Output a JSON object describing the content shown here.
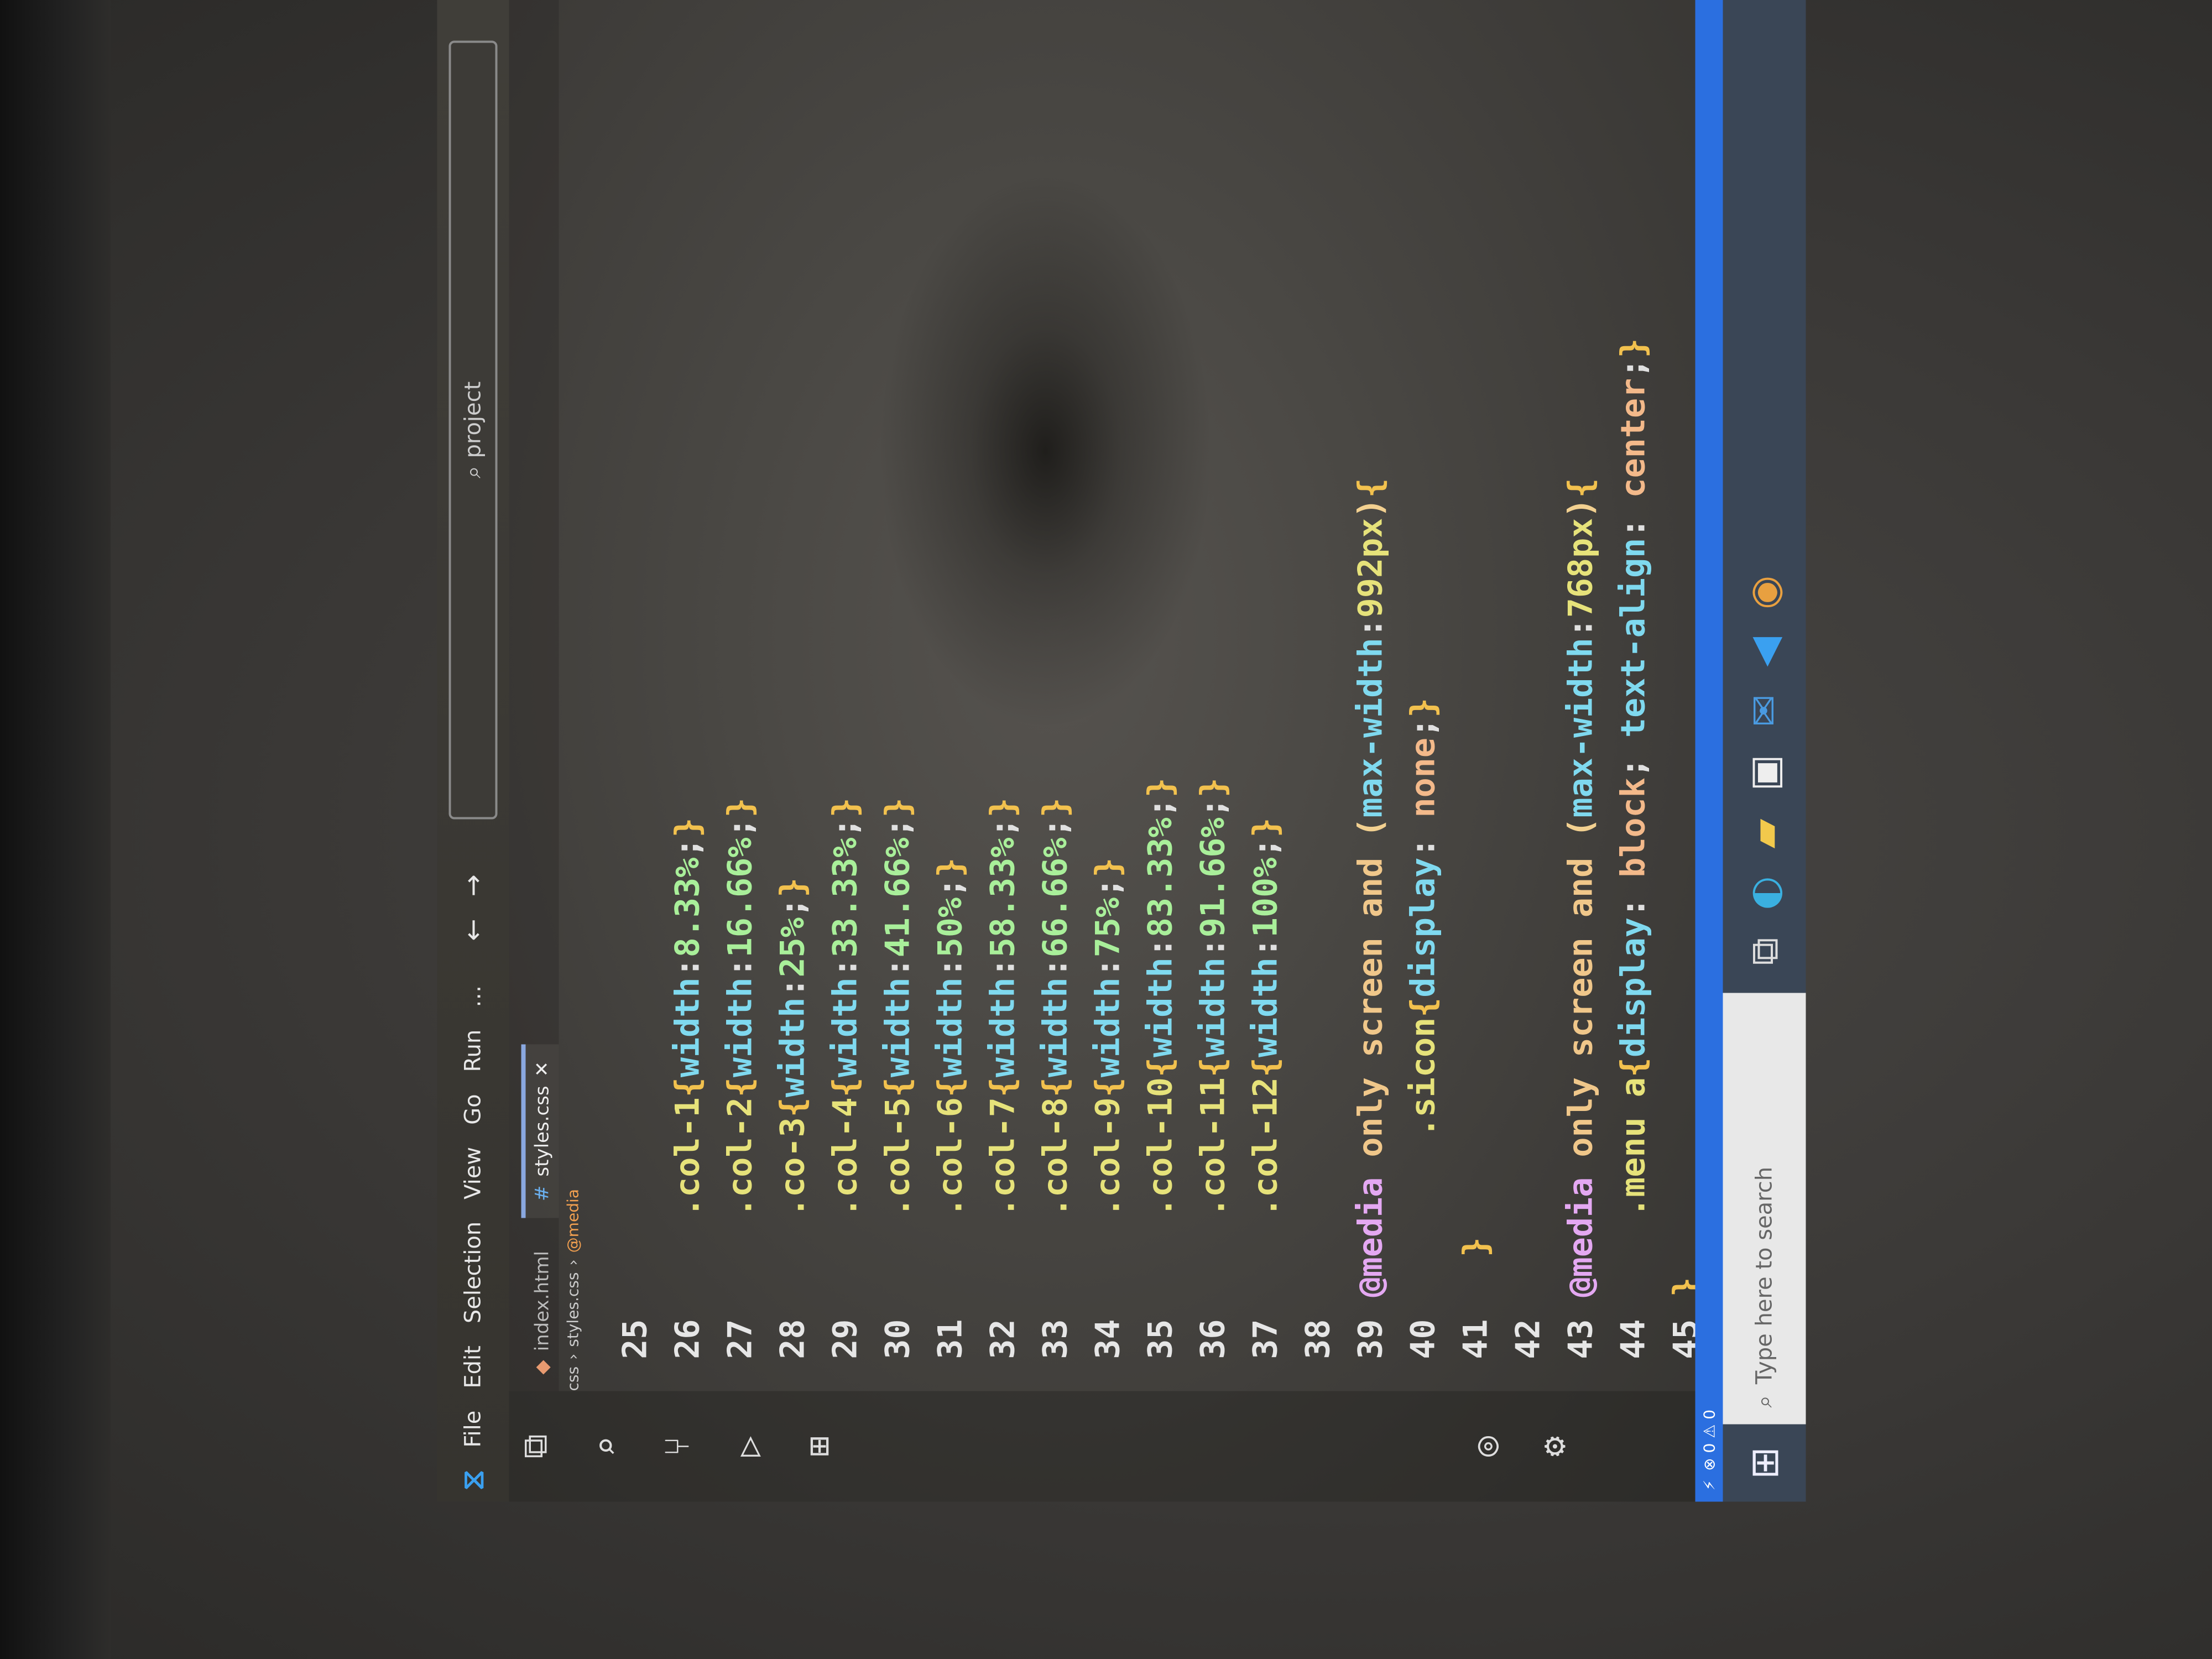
{
  "titlebar": {
    "menu": [
      "File",
      "Edit",
      "Selection",
      "View",
      "Go",
      "Run",
      "…"
    ],
    "search_placeholder": "project"
  },
  "tabs": [
    {
      "label": "index.html",
      "active": false
    },
    {
      "label": "styles.css",
      "active": true,
      "close": "✕"
    }
  ],
  "breadcrumb": [
    "css",
    "styles.css",
    "@media"
  ],
  "code": {
    "lines": [
      {
        "n": "25",
        "tokens": []
      },
      {
        "n": "26",
        "tokens": [
          [
            "    .col-1",
            "sel"
          ],
          [
            "{",
            "brace"
          ],
          [
            "width",
            "prop"
          ],
          [
            ":",
            "punc"
          ],
          [
            "8.33%",
            "val"
          ],
          [
            ";",
            "punc"
          ],
          [
            "}",
            "brace"
          ]
        ]
      },
      {
        "n": "27",
        "tokens": [
          [
            "    .col-2",
            "sel"
          ],
          [
            "{",
            "brace"
          ],
          [
            "width",
            "prop"
          ],
          [
            ":",
            "punc"
          ],
          [
            "16.66%",
            "val"
          ],
          [
            ";",
            "punc"
          ],
          [
            "}",
            "brace"
          ]
        ]
      },
      {
        "n": "28",
        "tokens": [
          [
            "    .co-3",
            "sel"
          ],
          [
            "{",
            "brace"
          ],
          [
            "width",
            "prop"
          ],
          [
            ":",
            "punc"
          ],
          [
            "25%",
            "val"
          ],
          [
            ";",
            "punc"
          ],
          [
            "}",
            "brace"
          ]
        ]
      },
      {
        "n": "29",
        "tokens": [
          [
            "    .col-4",
            "sel"
          ],
          [
            "{",
            "brace"
          ],
          [
            "width",
            "prop"
          ],
          [
            ":",
            "punc"
          ],
          [
            "33.33%",
            "val"
          ],
          [
            ";",
            "punc"
          ],
          [
            "}",
            "brace"
          ]
        ]
      },
      {
        "n": "30",
        "tokens": [
          [
            "    .col-5",
            "sel"
          ],
          [
            "{",
            "brace"
          ],
          [
            "width",
            "prop"
          ],
          [
            ":",
            "punc"
          ],
          [
            "41.66%",
            "val"
          ],
          [
            ";",
            "punc"
          ],
          [
            "}",
            "brace"
          ]
        ]
      },
      {
        "n": "31",
        "tokens": [
          [
            "    .col-6",
            "sel"
          ],
          [
            "{",
            "brace"
          ],
          [
            "width",
            "prop"
          ],
          [
            ":",
            "punc"
          ],
          [
            "50%",
            "val"
          ],
          [
            ";",
            "punc"
          ],
          [
            "}",
            "brace"
          ]
        ]
      },
      {
        "n": "32",
        "tokens": [
          [
            "    .col-7",
            "sel"
          ],
          [
            "{",
            "brace"
          ],
          [
            "width",
            "prop"
          ],
          [
            ":",
            "punc"
          ],
          [
            "58.33%",
            "val"
          ],
          [
            ";",
            "punc"
          ],
          [
            "}",
            "brace"
          ]
        ]
      },
      {
        "n": "33",
        "tokens": [
          [
            "    .col-8",
            "sel"
          ],
          [
            "{",
            "brace"
          ],
          [
            "width",
            "prop"
          ],
          [
            ":",
            "punc"
          ],
          [
            "66.66%",
            "val"
          ],
          [
            ";",
            "punc"
          ],
          [
            "}",
            "brace"
          ]
        ]
      },
      {
        "n": "34",
        "tokens": [
          [
            "    .col-9",
            "sel"
          ],
          [
            "{",
            "brace"
          ],
          [
            "width",
            "prop"
          ],
          [
            ":",
            "punc"
          ],
          [
            "75%",
            "val"
          ],
          [
            ";",
            "punc"
          ],
          [
            "}",
            "brace"
          ]
        ]
      },
      {
        "n": "35",
        "tokens": [
          [
            "    .col-10",
            "sel"
          ],
          [
            "{",
            "brace"
          ],
          [
            "width",
            "prop"
          ],
          [
            ":",
            "punc"
          ],
          [
            "83.33%",
            "val"
          ],
          [
            ";",
            "punc"
          ],
          [
            "}",
            "brace"
          ]
        ]
      },
      {
        "n": "36",
        "tokens": [
          [
            "    .col-11",
            "sel"
          ],
          [
            "{",
            "brace"
          ],
          [
            "width",
            "prop"
          ],
          [
            ":",
            "punc"
          ],
          [
            "91.66%",
            "val"
          ],
          [
            ";",
            "punc"
          ],
          [
            "}",
            "brace"
          ]
        ]
      },
      {
        "n": "37",
        "tokens": [
          [
            "    .col-12",
            "sel"
          ],
          [
            "{",
            "brace"
          ],
          [
            "width",
            "prop"
          ],
          [
            ":",
            "punc"
          ],
          [
            "100%",
            "val"
          ],
          [
            ";",
            "punc"
          ],
          [
            "}",
            "brace"
          ]
        ]
      },
      {
        "n": "38",
        "tokens": []
      },
      {
        "n": "39",
        "tokens": [
          [
            "@media",
            "at"
          ],
          [
            " only screen and ",
            "kw"
          ],
          [
            "(",
            "paren"
          ],
          [
            "max-width",
            "mq"
          ],
          [
            ":",
            "punc"
          ],
          [
            "992px",
            "num"
          ],
          [
            ")",
            "paren"
          ],
          [
            "{",
            "brace"
          ]
        ]
      },
      {
        "n": "40",
        "tokens": [
          [
            "        .sicon",
            "sel"
          ],
          [
            "{",
            "brace"
          ],
          [
            "display",
            "prop"
          ],
          [
            ": ",
            "punc"
          ],
          [
            "none",
            "str"
          ],
          [
            ";",
            "punc"
          ],
          [
            "}",
            "brace"
          ]
        ]
      },
      {
        "n": "41",
        "tokens": [
          [
            "  }",
            "brace"
          ]
        ]
      },
      {
        "n": "42",
        "tokens": []
      },
      {
        "n": "43",
        "tokens": [
          [
            "@media",
            "at"
          ],
          [
            " only screen and ",
            "kw"
          ],
          [
            "(",
            "paren"
          ],
          [
            "max-width",
            "mq"
          ],
          [
            ":",
            "punc"
          ],
          [
            "768px",
            "num"
          ],
          [
            ")",
            "paren"
          ],
          [
            "{",
            "brace"
          ]
        ]
      },
      {
        "n": "44",
        "tokens": [
          [
            "    .menu a",
            "sel"
          ],
          [
            "{",
            "brace"
          ],
          [
            "display",
            "prop"
          ],
          [
            ": ",
            "punc"
          ],
          [
            "block",
            "str"
          ],
          [
            "; ",
            "punc"
          ],
          [
            "text-align",
            "prop"
          ],
          [
            ": ",
            "punc"
          ],
          [
            "center",
            "str"
          ],
          [
            ";",
            "punc"
          ],
          [
            "}",
            "brace"
          ]
        ]
      },
      {
        "n": "45",
        "tokens": [
          [
            "}",
            "brace"
          ]
        ]
      }
    ]
  },
  "taskbar": {
    "search_placeholder": "Type here to search",
    "tray": "^"
  },
  "colors": {
    "status_bar": "#2b6fe0",
    "selector": "#e6e27a",
    "property": "#7fd9ef",
    "value": "#a9ef9a",
    "media": "#e4a8f2"
  }
}
